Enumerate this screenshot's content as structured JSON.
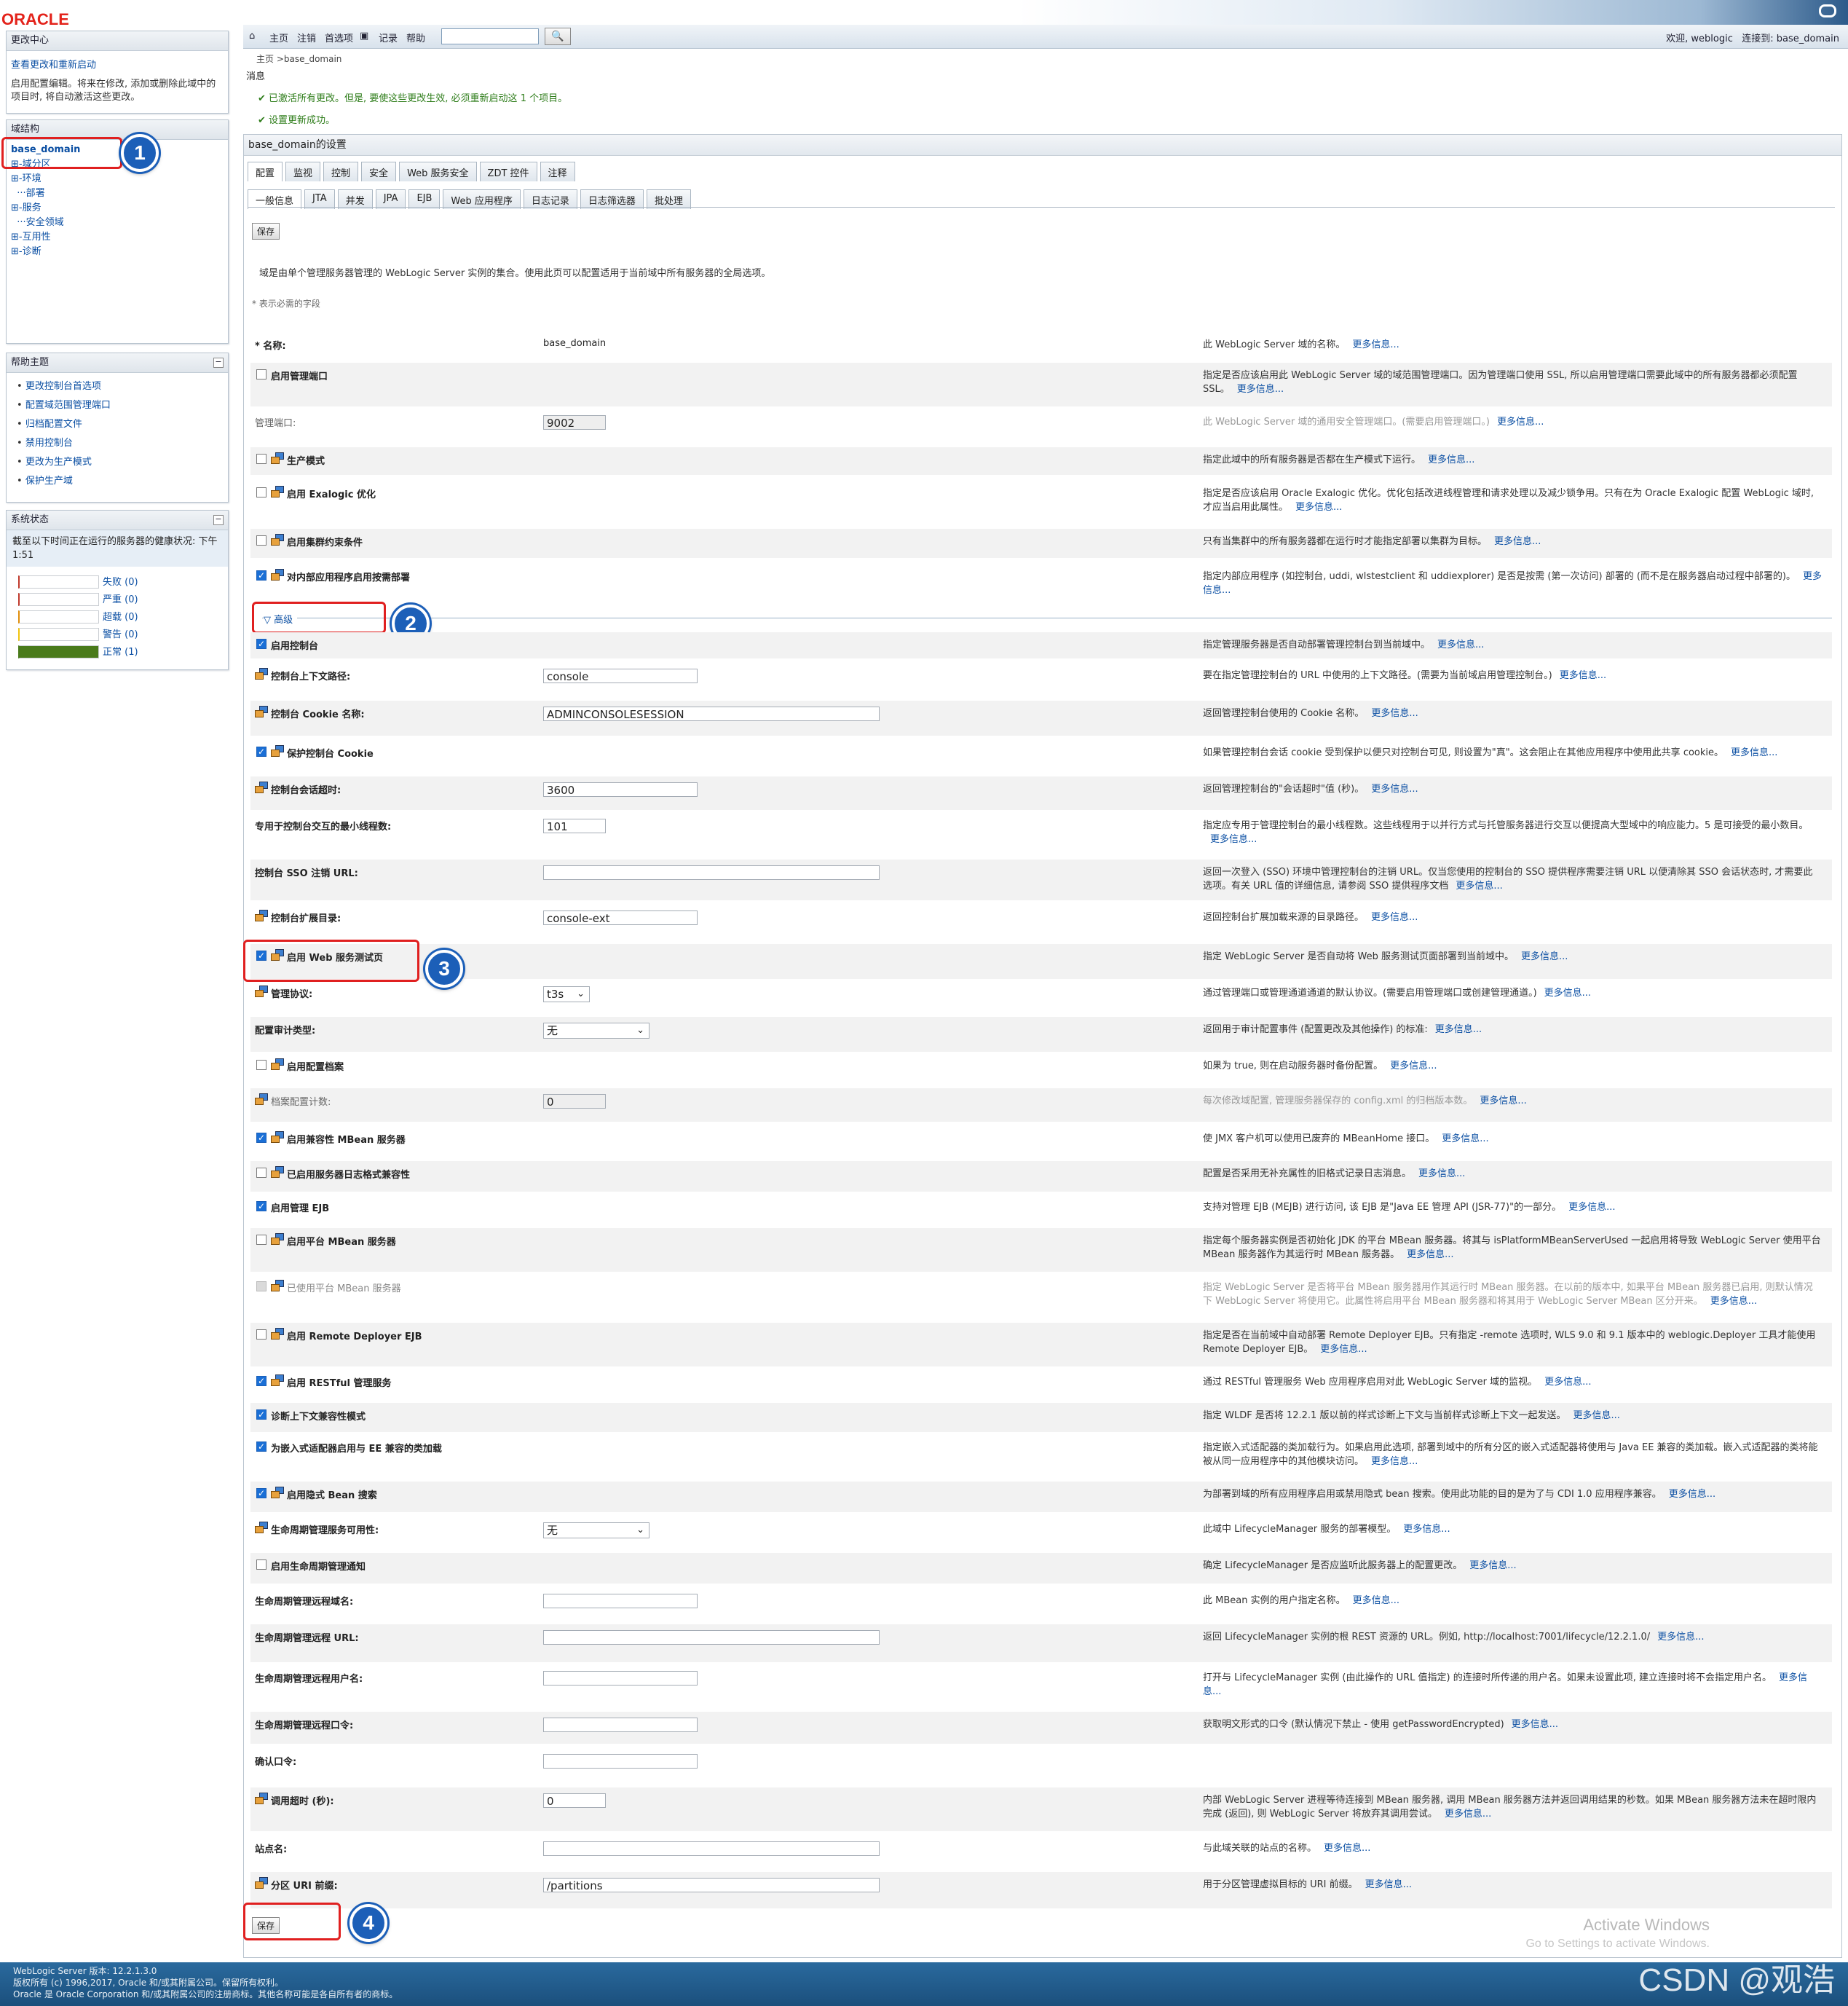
{
  "brand": {
    "logo": "ORACLE"
  },
  "toolbar": {
    "home": "主页",
    "logout": "注销",
    "prefs": "首选项",
    "record": "记录",
    "help": "帮助",
    "search_value": "",
    "welcome": "欢迎, weblogic",
    "connected": "连接到: base_domain"
  },
  "breadcrumb": "主页 >base_domain",
  "messages": {
    "title": "消息",
    "items": [
      "已激活所有更改。但是, 要使这些更改生效, 必须重新启动这 1 个项目。",
      "设置更新成功。"
    ]
  },
  "change_center": {
    "title": "更改中心",
    "link": "查看更改和重新启动",
    "text": "启用配置编辑。将来在修改, 添加或删除此域中的项目时, 将自动激活这些更改。"
  },
  "domain_structure": {
    "title": "域结构",
    "root": "base_domain",
    "items": [
      "⊞-域分区",
      "⊞-环境",
      "  ···部署",
      "⊞-服务",
      "  ···安全领域",
      "⊞-互用性",
      "⊞-诊断"
    ]
  },
  "help_topics": {
    "title": "帮助主题",
    "items": [
      "更改控制台首选项",
      "配置域范围管理端口",
      "归档配置文件",
      "禁用控制台",
      "更改为生产模式",
      "保护生产域"
    ]
  },
  "system_status": {
    "title": "系统状态",
    "text": "截至以下时间正在运行的服务器的健康状况: 下午1:51",
    "rows": [
      {
        "label": "失败 (0)",
        "fill": 0,
        "color": "#c0392b"
      },
      {
        "label": "严重 (0)",
        "fill": 0,
        "color": "#c0392b"
      },
      {
        "label": "超载 (0)",
        "fill": 0,
        "color": "#e08e0b"
      },
      {
        "label": "警告 (0)",
        "fill": 0,
        "color": "#f1c40f"
      },
      {
        "label": "正常 (1)",
        "fill": 1,
        "color": "#4a7b1b"
      }
    ]
  },
  "settings": {
    "title": "base_domain的设置",
    "tabs": [
      "配置",
      "监视",
      "控制",
      "安全",
      "Web 服务安全",
      "ZDT 控件",
      "注释"
    ],
    "subtabs": [
      "一般信息",
      "JTA",
      "并发",
      "JPA",
      "EJB",
      "Web 应用程序",
      "日志记录",
      "日志筛选器",
      "批处理"
    ],
    "save": "保存",
    "intro": "域是由单个管理服务器管理的 WebLogic Server 实例的集合。使用此页可以配置适用于当前域中所有服务器的全局选项。",
    "required_note": "* 表示必需的字段",
    "advanced": "高级",
    "more": "更多信息...",
    "rows": [
      {
        "label": "* 名称:",
        "value": "base_domain",
        "desc": "此 WebLogic Server 域的名称。"
      },
      {
        "label": "启用管理端口",
        "desc": "指定是否应该启用此 WebLogic Server 域的域范围管理端口。因为管理端口使用 SSL, 所以启用管理端口需要此域中的所有服务器都必须配置 SSL。"
      },
      {
        "label": "管理端口:",
        "value": "9002",
        "desc": "此 WebLogic Server 域的通用安全管理端口。(需要启用管理端口。)"
      },
      {
        "label": "生产模式",
        "desc": "指定此域中的所有服务器是否都在生产模式下运行。"
      },
      {
        "label": "启用 Exalogic 优化",
        "desc": "指定是否应该启用 Oracle Exalogic 优化。优化包括改进线程管理和请求处理以及减少锁争用。只有在为 Oracle Exalogic 配置 WebLogic 域时, 才应当启用此属性。"
      },
      {
        "label": "启用集群约束条件",
        "desc": "只有当集群中的所有服务器都在运行时才能指定部署以集群为目标。"
      },
      {
        "label": "对内部应用程序启用按需部署",
        "desc": "指定内部应用程序 (如控制台, uddi, wlstestclient 和 uddiexplorer) 是否是按需 (第一次访问) 部署的 (而不是在服务器启动过程中部署的)。"
      },
      {
        "label": "启用控制台",
        "desc": "指定管理服务器是否自动部署管理控制台到当前域中。"
      },
      {
        "label": "控制台上下文路径:",
        "value": "console",
        "desc": "要在指定管理控制台的 URL 中使用的上下文路径。(需要为当前域启用管理控制台。)"
      },
      {
        "label": "控制台 Cookie 名称:",
        "value": "ADMINCONSOLESESSION",
        "desc": "返回管理控制台使用的 Cookie 名称。"
      },
      {
        "label": "保护控制台 Cookie",
        "desc": "如果管理控制台会话 cookie 受到保护以便只对控制台可见, 则设置为\"真\"。这会阻止在其他应用程序中使用此共享 cookie。"
      },
      {
        "label": "控制台会话超时:",
        "value": "3600",
        "desc": "返回管理控制台的\"会话超时\"值 (秒)。"
      },
      {
        "label": "专用于控制台交互的最小线程数:",
        "value": "101",
        "desc": "指定应专用于管理控制台的最小线程数。这些线程用于以并行方式与托管服务器进行交互以便提高大型域中的响应能力。5 是可接受的最小数目。"
      },
      {
        "label": "控制台 SSO 注销 URL:",
        "value": "",
        "desc": "返回一次登入 (SSO) 环境中管理控制台的注销 URL。仅当您使用的控制台的 SSO 提供程序需要注销 URL 以便清除其 SSO 会话状态时, 才需要此选项。有关 URL 值的详细信息, 请参阅 SSO 提供程序文档"
      },
      {
        "label": "控制台扩展目录:",
        "value": "console-ext",
        "desc": "返回控制台扩展加载来源的目录路径。"
      },
      {
        "label": "启用 Web 服务测试页",
        "desc": "指定 WebLogic Server 是否自动将 Web 服务测试页面部署到当前域中。"
      },
      {
        "label": "管理协议:",
        "value": "t3s",
        "desc": "通过管理端口或管理通道通道的默认协议。(需要启用管理端口或创建管理通道。)"
      },
      {
        "label": "配置审计类型:",
        "value": "无",
        "desc": "返回用于审计配置事件 (配置更改及其他操作) 的标准:"
      },
      {
        "label": "启用配置档案",
        "desc": "如果为 true, 则在启动服务器时备份配置。"
      },
      {
        "label": "档案配置计数:",
        "value": "0",
        "desc": "每次修改域配置, 管理服务器保存的 config.xml 的归档版本数。"
      },
      {
        "label": "启用兼容性 MBean 服务器",
        "desc": "使 JMX 客户机可以使用已废弃的 MBeanHome 接口。"
      },
      {
        "label": "已启用服务器日志格式兼容性",
        "desc": "配置是否采用无补充属性的旧格式记录日志消息。"
      },
      {
        "label": "启用管理 EJB",
        "desc": "支持对管理 EJB (MEJB) 进行访问, 该 EJB 是\"Java EE 管理 API (JSR-77)\"的一部分。"
      },
      {
        "label": "启用平台 MBean 服务器",
        "desc": "指定每个服务器实例是否初始化 JDK 的平台 MBean 服务器。将其与 isPlatformMBeanServerUsed 一起启用将导致 WebLogic Server 使用平台 MBean 服务器作为其运行时 MBean 服务器。"
      },
      {
        "label": "已使用平台 MBean 服务器",
        "desc": "指定 WebLogic Server 是否将平台 MBean 服务器用作其运行时 MBean 服务器。在以前的版本中, 如果平台 MBean 服务器已启用, 则默认情况下 WebLogic Server 将使用它。此属性将启用平台 MBean 服务器和将其用于 WebLogic Server MBean 区分开来。"
      },
      {
        "label": "启用 Remote Deployer EJB",
        "desc": "指定是否在当前域中自动部署 Remote Deployer EJB。只有指定 -remote 选项时, WLS 9.0 和 9.1 版本中的 weblogic.Deployer 工具才能使用 Remote Deployer EJB。"
      },
      {
        "label": "启用 RESTful 管理服务",
        "desc": "通过 RESTful 管理服务 Web 应用程序启用对此 WebLogic Server 域的监视。"
      },
      {
        "label": "诊断上下文兼容性模式",
        "desc": "指定 WLDF 是否将 12.2.1 版以前的样式诊断上下文与当前样式诊断上下文一起发送。"
      },
      {
        "label": "为嵌入式适配器启用与 EE 兼容的类加载",
        "desc": "指定嵌入式适配器的类加载行为。如果启用此选项, 部署到域中的所有分区的嵌入式适配器将使用与 Java EE 兼容的类加载。嵌入式适配器的类将能被从同一应用程序中的其他模块访问。"
      },
      {
        "label": "启用隐式 Bean 搜索",
        "desc": "为部署到域的所有应用程序启用或禁用隐式 bean 搜索。使用此功能的目的是为了与 CDI 1.0 应用程序兼容。"
      },
      {
        "label": "生命周期管理服务可用性:",
        "value": "无",
        "desc": "此域中 LifecycleManager 服务的部署模型。"
      },
      {
        "label": "启用生命周期管理通知",
        "desc": "确定 LifecycleManager 是否应监听此服务器上的配置更改。"
      },
      {
        "label": "生命周期管理远程域名:",
        "value": "",
        "desc": "此 MBean 实例的用户指定名称。"
      },
      {
        "label": "生命周期管理远程 URL:",
        "value": "",
        "desc": "返回 LifecycleManager 实例的根 REST 资源的 URL。例如, http://localhost:7001/lifecycle/12.2.1.0/"
      },
      {
        "label": "生命周期管理远程用户名:",
        "value": "",
        "desc": "打开与 LifecycleManager 实例 (由此操作的 URL 值指定) 的连接时所传递的用户名。如果未设置此项, 建立连接时将不会指定用户名。"
      },
      {
        "label": "生命周期管理远程口令:",
        "value": "",
        "desc": "获取明文形式的口令 (默认情况下禁止 - 使用 getPasswordEncrypted)"
      },
      {
        "label": "确认口令:",
        "value": "",
        "desc": ""
      },
      {
        "label": "调用超时 (秒):",
        "value": "0",
        "desc": "内部 WebLogic Server 进程等待连接到 MBean 服务器, 调用 MBean 服务器方法并返回调用结果的秒数。如果 MBean 服务器方法未在超时限内完成 (返回), 则 WebLogic Server 将放弃其调用尝试。"
      },
      {
        "label": "站点名:",
        "value": "",
        "desc": "与此域关联的站点的名称。"
      },
      {
        "label": "分区 URI 前缀:",
        "value": "/partitions",
        "desc": "用于分区管理虚拟目标的 URI 前缀。"
      }
    ]
  },
  "footer": {
    "version": "WebLogic Server 版本: 12.2.1.3.0",
    "copyright": "版权所有 (c) 1996,2017, Oracle 和/或其附属公司。保留所有权利。",
    "trademark": "Oracle 是 Oracle Corporation 和/或其附属公司的注册商标。其他名称可能是各自所有者的商标。"
  },
  "overlay": {
    "win1": "Activate Windows",
    "win2": "Go to Settings to activate Windows.",
    "csdn": "CSDN @观浩",
    "callouts": [
      "1",
      "2",
      "3",
      "4"
    ]
  }
}
